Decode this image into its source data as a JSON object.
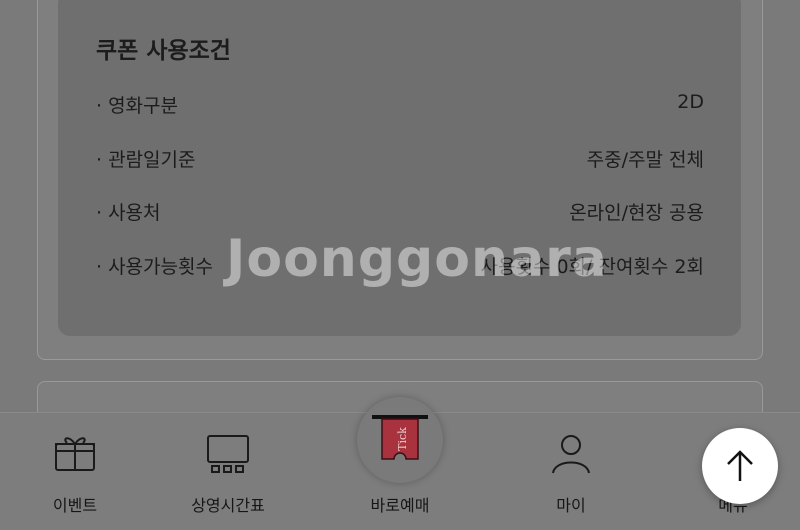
{
  "coupon": {
    "title": "쿠폰 사용조건",
    "rows": [
      {
        "label": "· 영화구분",
        "value": "2D"
      },
      {
        "label": "· 관람일기준",
        "value": "주중/주말 전체"
      },
      {
        "label": "· 사용처",
        "value": "온라인/현장 공용"
      },
      {
        "label": "· 사용가능횟수",
        "value": "사용횟수 0회/ 잔여횟수 2회"
      }
    ]
  },
  "tabbar": {
    "tabs": [
      {
        "label": "이벤트",
        "icon": "gift-icon"
      },
      {
        "label": "상영시간표",
        "icon": "schedule-icon"
      },
      {
        "label": "바로예매",
        "icon": "ticket-icon"
      },
      {
        "label": "마이",
        "icon": "user-icon"
      },
      {
        "label": "메뉴",
        "icon": "menu-icon"
      }
    ],
    "ticket_text": "Tick"
  },
  "watermark": "Joonggonara",
  "colors": {
    "ticket": "#a8323e",
    "scroll_button": "#ffffff"
  }
}
